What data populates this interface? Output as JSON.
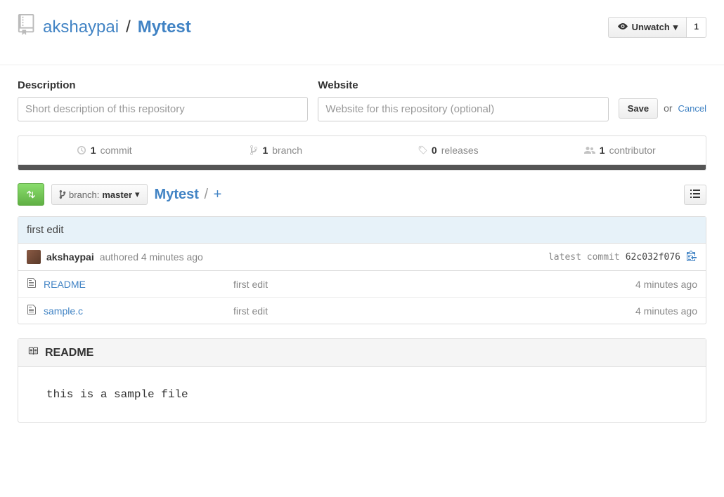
{
  "header": {
    "owner": "akshaypai",
    "repo": "Mytest",
    "unwatch_label": "Unwatch",
    "watch_count": "1"
  },
  "form": {
    "desc_label": "Description",
    "desc_placeholder": "Short description of this repository",
    "site_label": "Website",
    "site_placeholder": "Website for this repository (optional)",
    "save_label": "Save",
    "or_label": "or",
    "cancel_label": "Cancel"
  },
  "stats": {
    "commits_n": "1",
    "commits_l": "commit",
    "branches_n": "1",
    "branches_l": "branch",
    "releases_n": "0",
    "releases_l": "releases",
    "contrib_n": "1",
    "contrib_l": "contributor"
  },
  "branch": {
    "label": "branch:",
    "current": "master",
    "path_repo": "Mytest",
    "plus": "+"
  },
  "commit": {
    "message": "first edit",
    "author": "akshaypai",
    "authored_text": "authored 4 minutes ago",
    "latest_label": "latest commit",
    "sha": "62c032f076"
  },
  "files": [
    {
      "name": "README",
      "msg": "first edit",
      "date": "4 minutes ago"
    },
    {
      "name": "sample.c",
      "msg": "first edit",
      "date": "4 minutes ago"
    }
  ],
  "readme": {
    "title": "README",
    "body": "this is a sample file"
  }
}
